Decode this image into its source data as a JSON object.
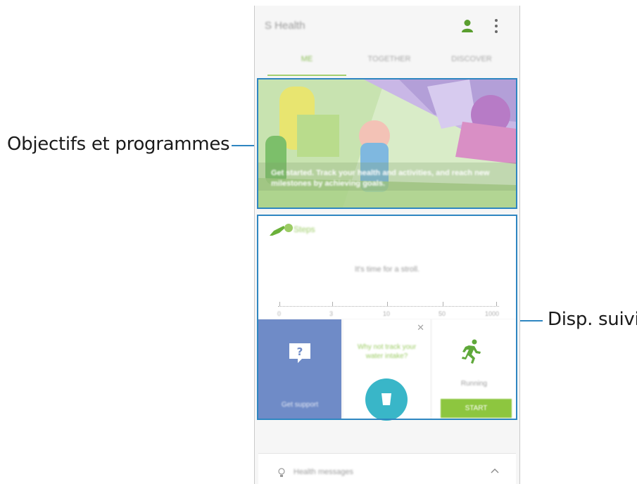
{
  "callouts": {
    "goals": "Objectifs et programmes",
    "trackers": "Disp. suivi"
  },
  "app": {
    "title": "S Health",
    "tabs": [
      {
        "label": "ME",
        "active": true
      },
      {
        "label": "TOGETHER",
        "active": false
      },
      {
        "label": "DISCOVER",
        "active": false
      }
    ],
    "accent_color": "#8dc63f",
    "highlight_color": "#2e86c1"
  },
  "banner": {
    "text": "Get started. Track your health and activities, and reach new milestones by achieving goals."
  },
  "steps": {
    "label": "Steps",
    "message": "It's time for a stroll.",
    "scale": [
      "0",
      "3",
      "10",
      "50",
      "1000"
    ]
  },
  "tiles": {
    "support": {
      "label": "Get support",
      "icon": "question-bubble-icon"
    },
    "water": {
      "question": "Why not track your water intake?",
      "icon": "cup-icon"
    },
    "running": {
      "label": "Running",
      "button": "START",
      "icon": "running-person-icon"
    }
  },
  "messages": {
    "label": "Health messages"
  }
}
